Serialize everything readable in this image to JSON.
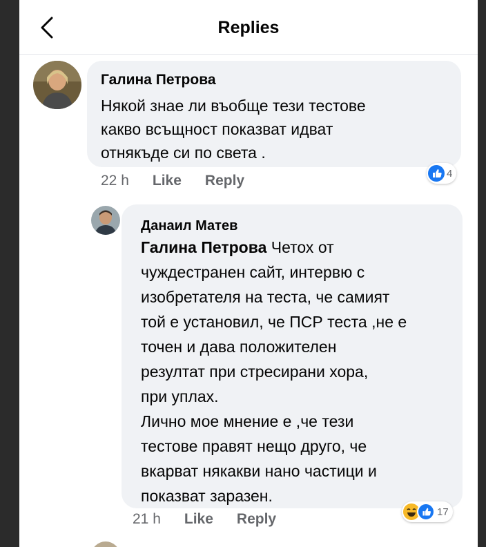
{
  "header": {
    "title": "Replies"
  },
  "comments": [
    {
      "author": "Галина Петрова",
      "text": "Някой знае ли въобще тези тестове\nкакво всъщност показват идват\nотнякъде си по света .",
      "time": "22 h",
      "like_label": "Like",
      "reply_label": "Reply",
      "reaction_count": "4"
    },
    {
      "author": "Данаил Матев",
      "mention": "Галина Петрова",
      "text_first_line": "Четох от",
      "text": "чуждестранен сайт, интервю с\nизобретателя на теста, че самият\nтой е установил, че ПСР теста ,не е\nточен и дава положителен\nрезултат при стресирани хора,\nпри уплах.\nЛично мое мнение е ,че тези\nтестове правят нещо друго, че\nвкарват някакви нано частици и\nпоказват заразен.",
      "time": "21 h",
      "like_label": "Like",
      "reply_label": "Reply",
      "reaction_count": "17"
    }
  ],
  "icons": {
    "back": "chevron-left-icon",
    "like_reaction": "like-reaction-icon",
    "haha_reaction": "haha-reaction-icon"
  },
  "colors": {
    "like_blue": "#1877f2",
    "haha_yellow": "#f7b928",
    "bubble_bg": "#f0f2f5",
    "muted_text": "#65676b"
  }
}
